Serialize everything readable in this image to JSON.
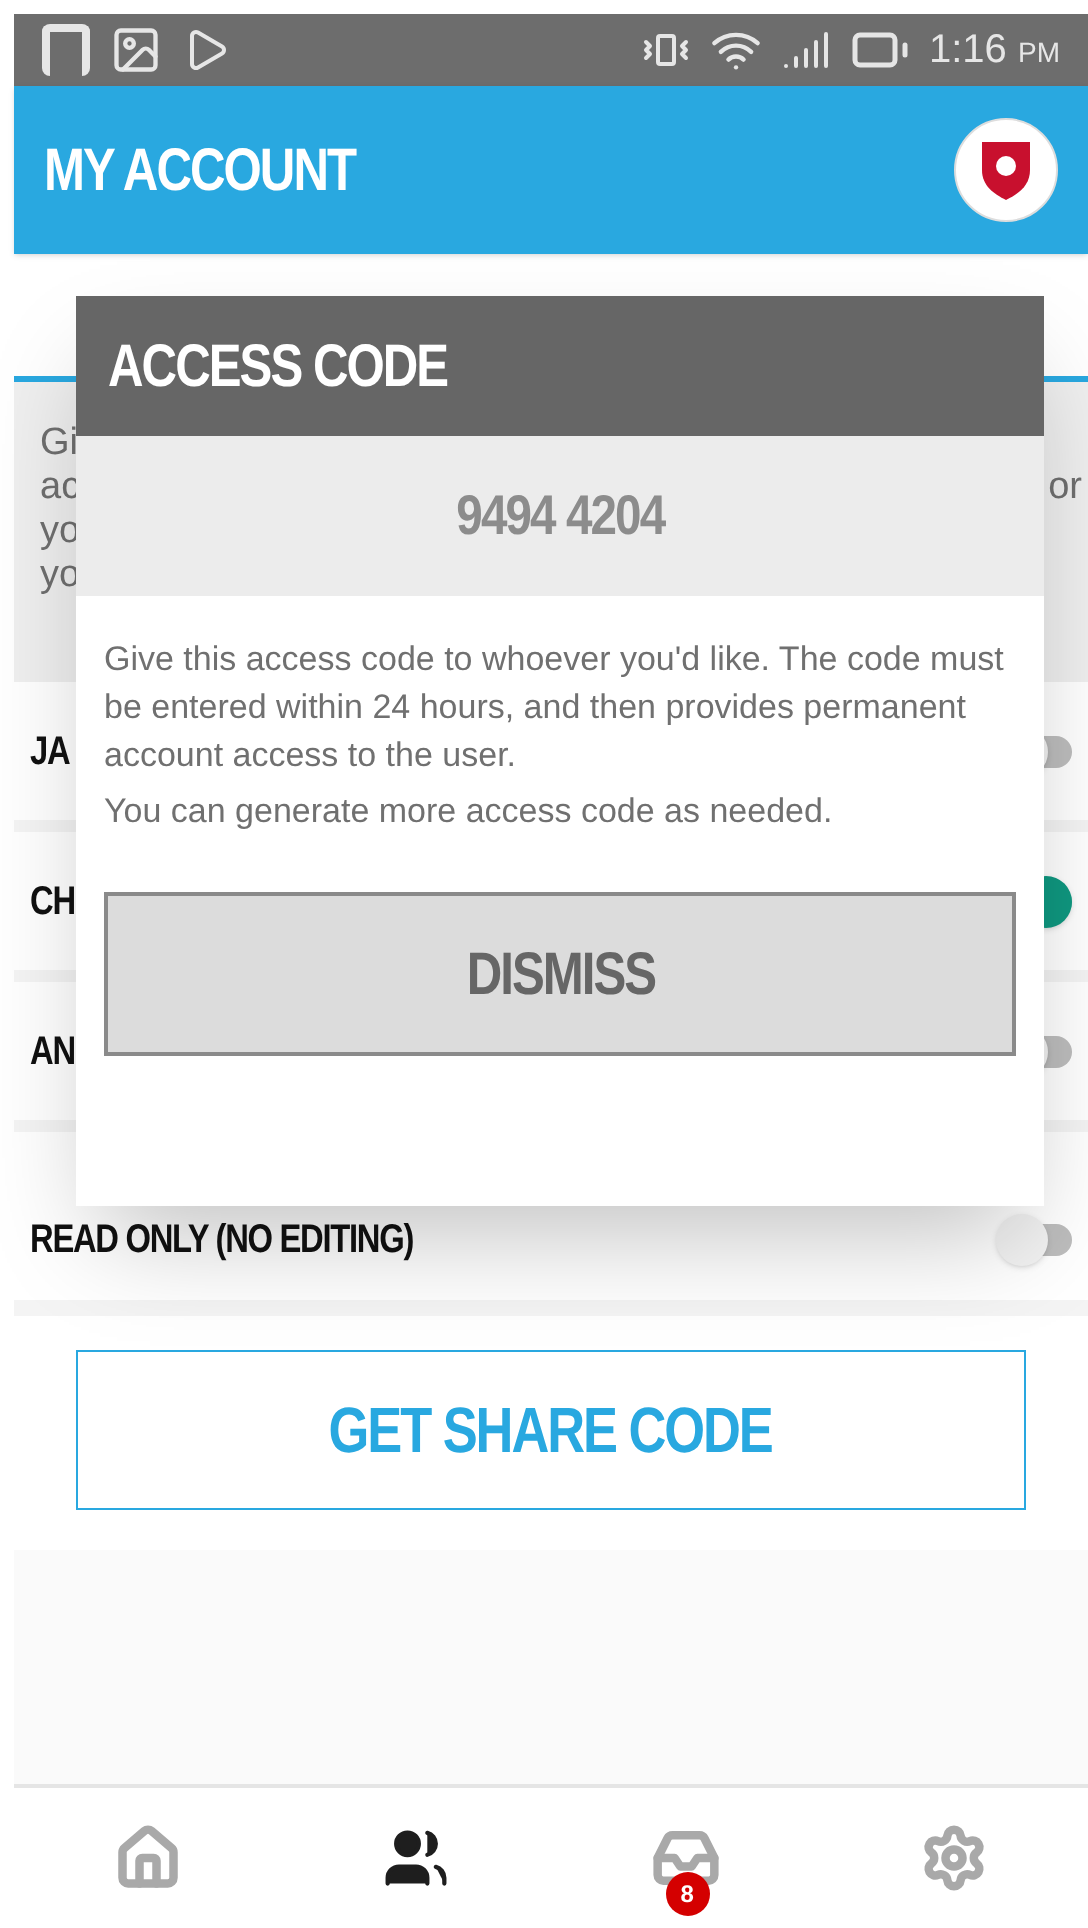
{
  "status_bar": {
    "time": "1:16",
    "meridiem": "PM"
  },
  "app_bar": {
    "title": "MY ACCOUNT"
  },
  "intro": {
    "left_fragments": [
      "Gi",
      "ac",
      "yo",
      "yo"
    ],
    "right_fragments": [
      "or"
    ]
  },
  "members": [
    {
      "label": "JA",
      "on": false
    },
    {
      "label": "CH",
      "on": true
    },
    {
      "label": "AN",
      "on": false
    }
  ],
  "read_only": {
    "label": "READ ONLY (NO EDITING)",
    "on": false
  },
  "share_button": "GET SHARE CODE",
  "dialog": {
    "title": "ACCESS CODE",
    "code": "9494 4204",
    "message": "Give this access code to whoever you'd like. The code must be entered within 24 hours, and then provides permanent account access to the user.",
    "note": "You can generate more access code as needed.",
    "button": "DISMISS"
  },
  "bottom_nav": [
    {
      "kind": "home",
      "selected": false
    },
    {
      "kind": "people",
      "selected": true
    },
    {
      "kind": "inbox",
      "selected": false,
      "badge": "8"
    },
    {
      "kind": "settings",
      "selected": false
    }
  ]
}
